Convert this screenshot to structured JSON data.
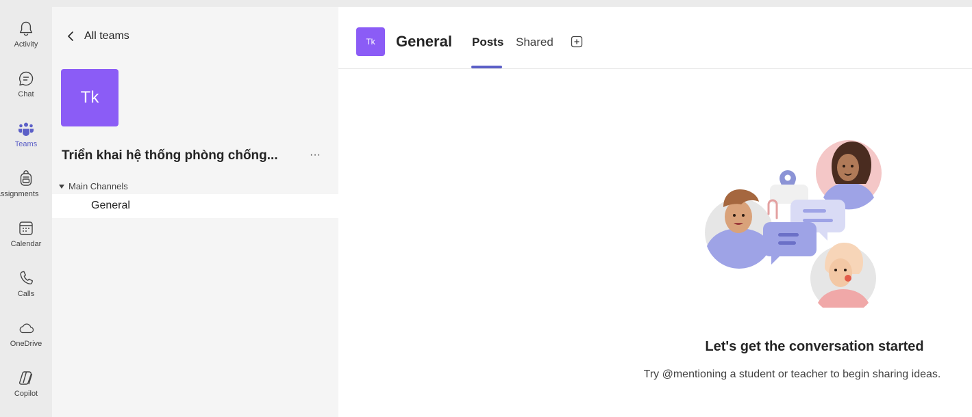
{
  "rail": {
    "items": [
      {
        "label": "Activity",
        "icon": "bell-icon"
      },
      {
        "label": "Chat",
        "icon": "chat-icon"
      },
      {
        "label": "Teams",
        "icon": "teams-icon",
        "active": true
      },
      {
        "label": "Assignments",
        "icon": "backpack-icon"
      },
      {
        "label": "Calendar",
        "icon": "calendar-icon"
      },
      {
        "label": "Calls",
        "icon": "phone-icon"
      },
      {
        "label": "OneDrive",
        "icon": "cloud-icon"
      },
      {
        "label": "Copilot",
        "icon": "copilot-icon"
      }
    ]
  },
  "team_panel": {
    "back_label": "All teams",
    "avatar_text": "Tk",
    "team_name": "Triển khai hệ thống phòng chống...",
    "more_label": "···",
    "section_label": "Main Channels",
    "channels": [
      {
        "label": "General",
        "selected": true
      }
    ]
  },
  "main": {
    "channel_avatar": "Tk",
    "channel_title": "General",
    "tabs": [
      {
        "label": "Posts",
        "active": true
      },
      {
        "label": "Shared",
        "active": false
      }
    ],
    "empty_state": {
      "headline": "Let's get the conversation started",
      "subline": "Try @mentioning a student or teacher to begin sharing ideas."
    }
  },
  "colors": {
    "accent": "#5b5fc7",
    "team_avatar": "#8b5cf6",
    "rail_bg": "#ebebeb",
    "panel_bg": "#f5f5f5"
  }
}
